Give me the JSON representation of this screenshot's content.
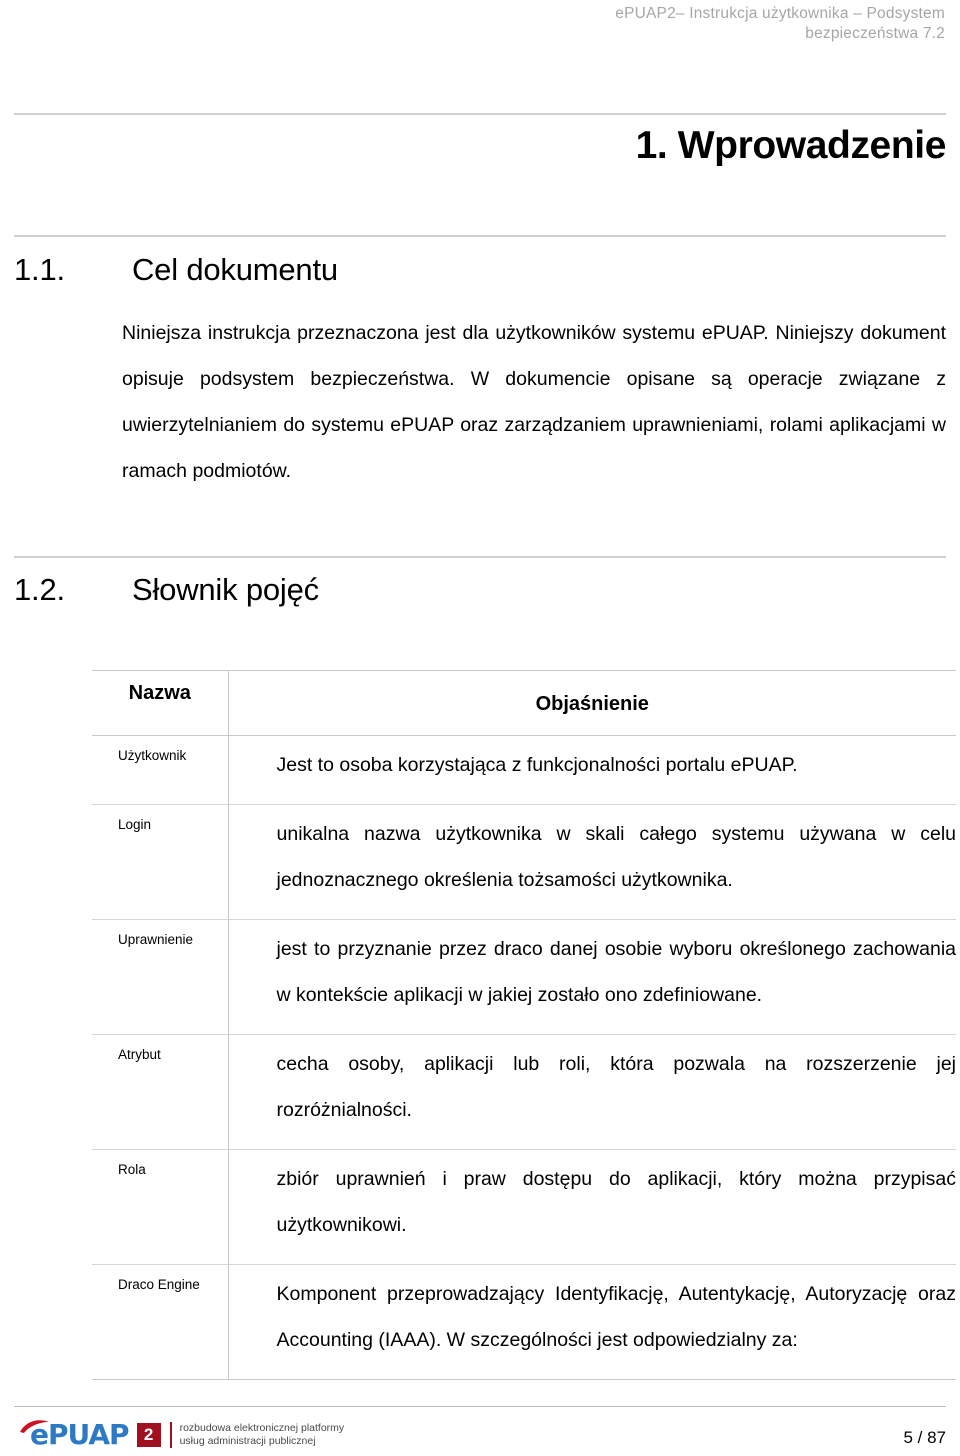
{
  "header": {
    "line1": "ePUAP2– Instrukcja użytkownika – Podsystem",
    "line2": "bezpieczeństwa 7.2"
  },
  "chapter": {
    "title": "1. Wprowadzenie"
  },
  "sections": [
    {
      "number": "1.1.",
      "title": "Cel dokumentu",
      "paragraph": "Niniejsza instrukcja przeznaczona jest dla użytkowników systemu ePUAP. Niniejszy dokument opisuje podsystem bezpieczeństwa. W dokumencie opisane są operacje związane z uwierzytelnianiem do systemu ePUAP oraz zarządzaniem uprawnieniami, rolami aplikacjami w ramach podmiotów."
    },
    {
      "number": "1.2.",
      "title": "Słownik pojęć"
    }
  ],
  "glossary": {
    "columns": [
      "Nazwa",
      "Objaśnienie"
    ],
    "rows": [
      {
        "name": "Użytkownik",
        "description": "Jest to osoba korzystająca z funkcjonalności portalu ePUAP."
      },
      {
        "name": "Login",
        "description": "unikalna nazwa użytkownika w skali całego systemu używana w celu jednoznacznego określenia tożsamości użytkownika."
      },
      {
        "name": "Uprawnienie",
        "description": "jest to przyznanie przez draco danej osobie wyboru określonego zachowania w kontekście aplikacji w jakiej zostało ono zdefiniowane."
      },
      {
        "name": "Atrybut",
        "description": "cecha osoby, aplikacji lub roli, która pozwala na rozszerzenie jej rozróżnialności."
      },
      {
        "name": "Rola",
        "description": "zbiór uprawnień i praw dostępu do aplikacji, który można przypisać użytkownikowi."
      },
      {
        "name": "Draco Engine",
        "description": "Komponent przeprowadzający Identyfikację, Autentykację, Autoryzację oraz Accounting (IAAA). W szczególności jest odpowiedzialny za:"
      }
    ]
  },
  "footer": {
    "logo_word": "ePUAP",
    "logo_badge": "2",
    "tagline_line1": "rozbudowa elektronicznej platformy",
    "tagline_line2": "usług administracji publicznej",
    "page_number": "5 / 87"
  },
  "colors": {
    "header_gray": "#a6a6a6",
    "rule_gray": "#cfcfcf",
    "logo_blue": "#2e79c4",
    "logo_red": "#a01020",
    "table_border": "#c9c9c9"
  }
}
